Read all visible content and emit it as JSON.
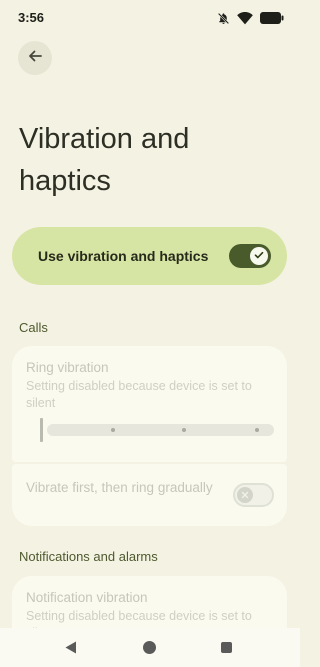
{
  "status_bar": {
    "time": "3:56"
  },
  "header": {
    "back_icon": "arrow-left-icon"
  },
  "page": {
    "title": "Vibration and haptics"
  },
  "main_toggle": {
    "label": "Use vibration and haptics",
    "state": "on"
  },
  "sections": {
    "calls": {
      "header": "Calls",
      "ring_vibration": {
        "title": "Ring vibration",
        "subtitle": "Setting disabled because device is set to silent",
        "slider_level": 0
      },
      "vibrate_first": {
        "title": "Vibrate first, then ring gradually",
        "state": "off"
      }
    },
    "notifications": {
      "header": "Notifications and alarms",
      "notification_vibration": {
        "title": "Notification vibration",
        "subtitle": "Setting disabled because device is set to silent"
      }
    }
  },
  "nav_bar": {
    "icons": [
      "back-icon",
      "home-icon",
      "recents-icon"
    ]
  },
  "colors": {
    "accent": "#d7e5a4",
    "switch_on": "#4a5b2b",
    "background": "#f4f2e3"
  }
}
